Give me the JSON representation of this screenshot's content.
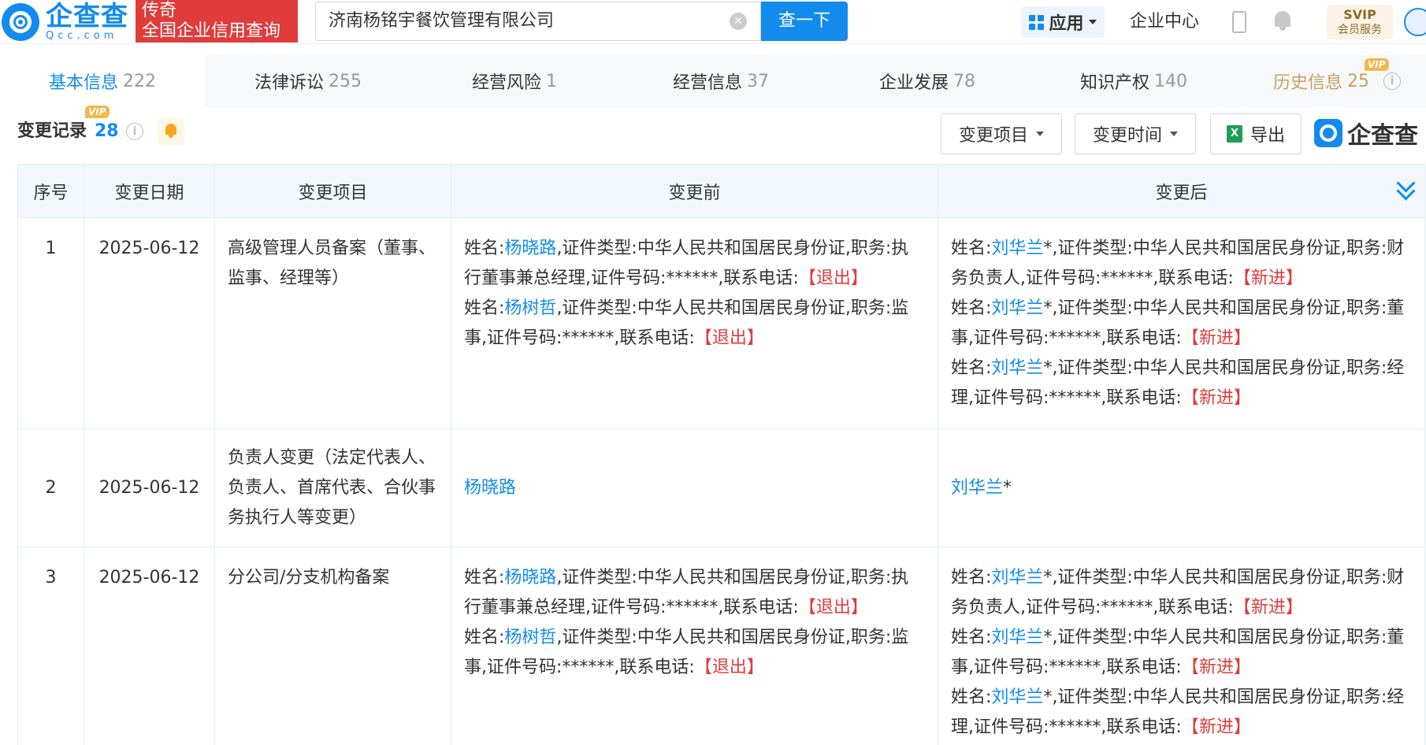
{
  "header": {
    "logo_cn": "企查查",
    "logo_en": "Qcc.com",
    "tag_line1": "传奇",
    "tag_line2": "全国企业信用查询",
    "search_value": "济南杨铭宇餐饮管理有限公司",
    "search_button": "查一下",
    "apps_label": "应用",
    "corp_center": "企业中心",
    "svip_line1": "SVIP",
    "svip_line2": "会员服务"
  },
  "tabs": [
    {
      "label": "基本信息",
      "count": "222"
    },
    {
      "label": "法律诉讼",
      "count": "255"
    },
    {
      "label": "经营风险",
      "count": "1"
    },
    {
      "label": "经营信息",
      "count": "37"
    },
    {
      "label": "企业发展",
      "count": "78"
    },
    {
      "label": "知识产权",
      "count": "140"
    },
    {
      "label": "历史信息",
      "count": "25"
    }
  ],
  "vip_label": "VIP",
  "info_glyph": "i",
  "section": {
    "title": "变更记录",
    "count": "28",
    "filter_item": "变更项目",
    "filter_time": "变更时间",
    "export": "导出",
    "excel_glyph": "X",
    "brand": "企查查"
  },
  "table": {
    "headers": [
      "序号",
      "变更日期",
      "变更项目",
      "变更前",
      "变更后"
    ],
    "rows": [
      {
        "no": "1",
        "date": "2025-06-12",
        "item": "高级管理人员备案（董事、监事、经理等）",
        "before": [
          {
            "p1": "姓名:",
            "name": "杨晓路",
            "p2": ",证件类型:中华人民共和国居民身份证,职务:执行董事兼总经理,证件号码:******,联系电话:",
            "tag": "【退出】"
          },
          {
            "p1": "姓名:",
            "name": "杨树哲",
            "p2": ",证件类型:中华人民共和国居民身份证,职务:监事,证件号码:******,联系电话:",
            "tag": "【退出】"
          }
        ],
        "after": [
          {
            "p1": "姓名:",
            "name": "刘华兰",
            "p2": "*,证件类型:中华人民共和国居民身份证,职务:财务负责人,证件号码:******,联系电话:",
            "tag": "【新进】"
          },
          {
            "p1": "姓名:",
            "name": "刘华兰",
            "p2": "*,证件类型:中华人民共和国居民身份证,职务:董事,证件号码:******,联系电话:",
            "tag": "【新进】"
          },
          {
            "p1": "姓名:",
            "name": "刘华兰",
            "p2": "*,证件类型:中华人民共和国居民身份证,职务:经理,证件号码:******,联系电话:",
            "tag": "【新进】"
          }
        ]
      },
      {
        "no": "2",
        "date": "2025-06-12",
        "item": "负责人变更（法定代表人、负责人、首席代表、合伙事务执行人等变更）",
        "before_name": "杨晓路",
        "after_name": "刘华兰",
        "after_suffix": "*"
      },
      {
        "no": "3",
        "date": "2025-06-12",
        "item": "分公司/分支机构备案",
        "before": [
          {
            "p1": "姓名:",
            "name": "杨晓路",
            "p2": ",证件类型:中华人民共和国居民身份证,职务:执行董事兼总经理,证件号码:******,联系电话:",
            "tag": "【退出】"
          },
          {
            "p1": "姓名:",
            "name": "杨树哲",
            "p2": ",证件类型:中华人民共和国居民身份证,职务:监事,证件号码:******,联系电话:",
            "tag": "【退出】"
          }
        ],
        "after": [
          {
            "p1": "姓名:",
            "name": "刘华兰",
            "p2": "*,证件类型:中华人民共和国居民身份证,职务:财务负责人,证件号码:******,联系电话:",
            "tag": "【新进】"
          },
          {
            "p1": "姓名:",
            "name": "刘华兰",
            "p2": "*,证件类型:中华人民共和国居民身份证,职务:董事,证件号码:******,联系电话:",
            "tag": "【新进】"
          },
          {
            "p1": "姓名:",
            "name": "刘华兰",
            "p2": "*,证件类型:中华人民共和国居民身份证,职务:经理,证件号码:******,联系电话:",
            "tag": "【新进】"
          }
        ]
      }
    ]
  },
  "colors": {
    "brand": "#128bed",
    "red": "#e03c3c",
    "vip": "#f1b84c",
    "history": "#c9a063"
  }
}
